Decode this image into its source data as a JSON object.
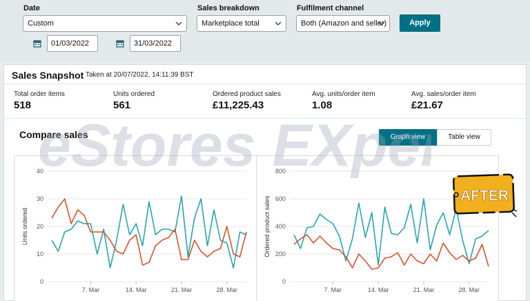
{
  "filters": {
    "date_label": "Date",
    "date_value": "Custom",
    "breakdown_label": "Sales breakdown",
    "breakdown_value": "Marketplace total",
    "channel_label": "Fulfilment channel",
    "channel_value": "Both (Amazon and seller)",
    "apply_label": "Apply",
    "start_date": "01/03/2022",
    "end_date": "31/03/2022"
  },
  "snapshot": {
    "title": "Sales Snapshot",
    "taken": "Taken at 20/07/2022, 14:11:39 BST",
    "metrics": [
      {
        "label": "Total order items",
        "value": "518"
      },
      {
        "label": "Units ordered",
        "value": "561"
      },
      {
        "label": "Ordered product sales",
        "value": "£11,225.43"
      },
      {
        "label": "Avg. units/order item",
        "value": "1.08"
      },
      {
        "label": "Avg. sales/order item",
        "value": "£21.67"
      }
    ]
  },
  "compare": {
    "title": "Compare sales",
    "graph_view_label": "Graph view",
    "table_view_label": "Table view"
  },
  "watermark": {
    "text": "eStores EXperts"
  },
  "badge": {
    "text": "AFTER"
  },
  "colors": {
    "teal": "#2aa3ad",
    "orange": "#d4512e",
    "accent": "#007185"
  },
  "chart_data": [
    {
      "type": "line",
      "ylabel": "Units ordered",
      "ylim": [
        0,
        40
      ],
      "yticks": [
        "0",
        "10",
        "20",
        "30",
        "40"
      ],
      "xticks": [
        {
          "day": 7,
          "label": "7. Mar"
        },
        {
          "day": 14,
          "label": "14. Mar"
        },
        {
          "day": 21,
          "label": "21. Mar"
        },
        {
          "day": 28,
          "label": "28. Mar"
        }
      ],
      "x": [
        1,
        2,
        3,
        4,
        5,
        6,
        7,
        8,
        9,
        10,
        11,
        12,
        13,
        14,
        15,
        16,
        17,
        18,
        19,
        20,
        21,
        22,
        23,
        24,
        25,
        26,
        27,
        28,
        29,
        30,
        31
      ],
      "series": [
        {
          "color": "#2aa3ad",
          "values": [
            15,
            11,
            18,
            19,
            22,
            21,
            21,
            10,
            19,
            5,
            15,
            28,
            17,
            21,
            13,
            29,
            17,
            19,
            19,
            18,
            31,
            9,
            23,
            30,
            13,
            26,
            15,
            14,
            5,
            18,
            17
          ]
        },
        {
          "color": "#d4512e",
          "values": [
            23,
            27,
            30,
            21,
            26,
            24,
            18,
            18,
            18,
            15,
            11,
            10,
            15,
            17,
            6,
            7,
            13,
            15,
            16,
            19,
            8,
            8,
            15,
            11,
            9,
            11,
            12,
            20,
            10,
            9,
            18
          ]
        }
      ]
    },
    {
      "type": "line",
      "ylabel": "Ordered product sales",
      "ylim": [
        0,
        800
      ],
      "yticks": [
        "0",
        "200",
        "400",
        "600",
        "800"
      ],
      "xticks": [
        {
          "day": 7,
          "label": "7. Mar"
        },
        {
          "day": 14,
          "label": "14. Mar"
        },
        {
          "day": 21,
          "label": "21. Mar"
        },
        {
          "day": 28,
          "label": "28. Mar"
        }
      ],
      "x": [
        1,
        2,
        3,
        4,
        5,
        6,
        7,
        8,
        9,
        10,
        11,
        12,
        13,
        14,
        15,
        16,
        17,
        18,
        19,
        20,
        21,
        22,
        23,
        24,
        25,
        26,
        27,
        28,
        29,
        30,
        31
      ],
      "series": [
        {
          "color": "#2aa3ad",
          "values": [
            340,
            240,
            390,
            400,
            490,
            450,
            420,
            330,
            150,
            310,
            570,
            320,
            500,
            120,
            540,
            350,
            340,
            390,
            560,
            280,
            600,
            230,
            410,
            500,
            340,
            530,
            300,
            130,
            310,
            330,
            370
          ]
        },
        {
          "color": "#d4512e",
          "values": [
            270,
            310,
            340,
            280,
            330,
            280,
            240,
            230,
            180,
            100,
            200,
            150,
            90,
            100,
            170,
            180,
            210,
            120,
            200,
            150,
            130,
            200,
            150,
            280,
            210,
            160,
            190,
            150,
            170,
            270,
            110
          ]
        }
      ]
    }
  ]
}
